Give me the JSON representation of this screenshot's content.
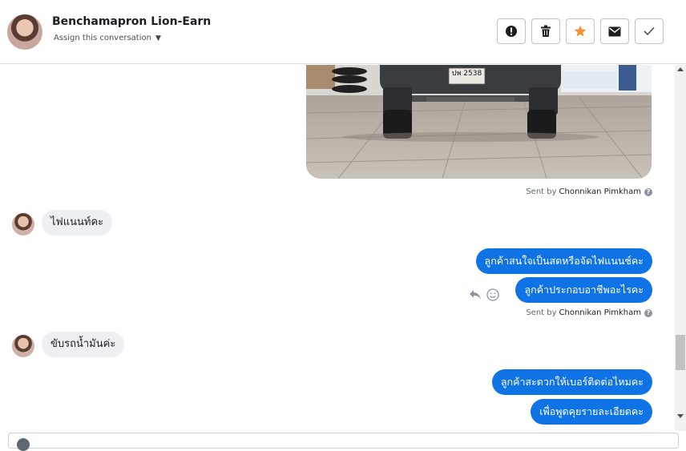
{
  "header": {
    "contact_name": "Benchamapron Lion-Earn",
    "assign_label": "Assign this conversation",
    "actions": [
      {
        "name": "mark-spam",
        "icon": "exclamation-icon"
      },
      {
        "name": "delete",
        "icon": "trash-icon"
      },
      {
        "name": "star",
        "icon": "star-icon"
      },
      {
        "name": "mark-unread",
        "icon": "envelope-icon"
      },
      {
        "name": "done",
        "icon": "check-icon"
      }
    ]
  },
  "conversation": {
    "photo": {
      "plate_text": "ปพ 2538"
    },
    "sent_by_label": "Sent by",
    "sender_name": "Chonnikan Pimkham",
    "help_glyph": "?",
    "incoming": [
      {
        "text": "ไฟแนนท์คะ"
      },
      {
        "text": "ขับรถน้ำมันค่ะ"
      }
    ],
    "outgoing": [
      {
        "text": "ลูกค้าสนใจเป็นสดหรือจัดไฟแนนช์คะ"
      },
      {
        "text": "ลูกค้าประกอบอาชีพอะไรคะ"
      },
      {
        "text": "ลูกค้าสะดวกให้เบอร์ติดต่อไหมคะ"
      },
      {
        "text": "เพื่อพูดคุยรายละเอียดคะ"
      }
    ]
  },
  "colors": {
    "outgoing_bubble": "#0f73e6",
    "incoming_bubble": "#eeeff2",
    "star_active": "#f5922f"
  }
}
